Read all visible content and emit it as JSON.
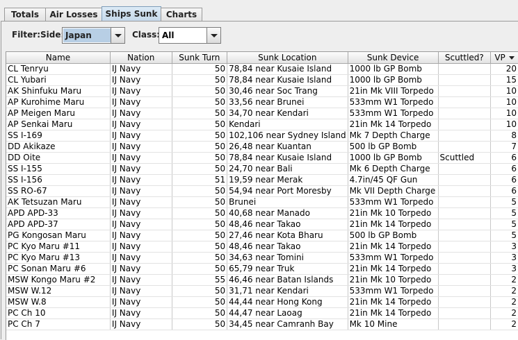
{
  "tabs": [
    {
      "label": "Totals"
    },
    {
      "label": "Air Losses"
    },
    {
      "label": "Ships Sunk",
      "active": true
    },
    {
      "label": "Charts"
    }
  ],
  "filter": {
    "label": "Filter:",
    "side_label": "Side:",
    "side_value": "Japan",
    "class_label": "Class:",
    "class_value": "All"
  },
  "table": {
    "columns": [
      "Name",
      "Nation",
      "Sunk Turn",
      "Sunk Location",
      "Sunk Device",
      "Scuttled?",
      "VP"
    ],
    "sorted_column": "VP",
    "sort_direction": "descending",
    "rows": [
      [
        "CL Tenryu",
        "IJ Navy",
        "50",
        "78,84 near Kusaie Island",
        "1000 lb GP Bomb",
        "",
        "20"
      ],
      [
        "CL Yubari",
        "IJ Navy",
        "50",
        "78,84 near Kusaie Island",
        "1000 lb GP Bomb",
        "",
        "15"
      ],
      [
        "AK Shinfuku Maru",
        "IJ Navy",
        "50",
        "30,46 near Soc Trang",
        "21in Mk VIII Torpedo",
        "",
        "10"
      ],
      [
        "AP Kurohime Maru",
        "IJ Navy",
        "50",
        "33,56 near Brunei",
        "533mm W1 Torpedo",
        "",
        "10"
      ],
      [
        "AP Meigen Maru",
        "IJ Navy",
        "50",
        "34,70 near Kendari",
        "533mm W1 Torpedo",
        "",
        "10"
      ],
      [
        "AP Senkai Maru",
        "IJ Navy",
        "50",
        "Kendari",
        "21in Mk 14 Torpedo",
        "",
        "10"
      ],
      [
        "SS I-169",
        "IJ Navy",
        "50",
        "102,106 near Sydney Island",
        "Mk 7 Depth Charge",
        "",
        "8"
      ],
      [
        "DD Akikaze",
        "IJ Navy",
        "50",
        "26,48 near Kuantan",
        "500 lb GP Bomb",
        "",
        "7"
      ],
      [
        "DD Oite",
        "IJ Navy",
        "50",
        "78,84 near Kusaie Island",
        "1000 lb GP Bomb",
        "Scuttled",
        "6"
      ],
      [
        "SS I-155",
        "IJ Navy",
        "50",
        "24,70 near Bali",
        "Mk 6 Depth Charge",
        "",
        "6"
      ],
      [
        "SS I-156",
        "IJ Navy",
        "51",
        "19,59 near Merak",
        "4.7in/45 QF Gun",
        "",
        "6"
      ],
      [
        "SS RO-67",
        "IJ Navy",
        "50",
        "54,94 near Port Moresby",
        "Mk VII Depth Charge",
        "",
        "6"
      ],
      [
        "AK Tetsuzan Maru",
        "IJ Navy",
        "50",
        "Brunei",
        "533mm W1 Torpedo",
        "",
        "5"
      ],
      [
        "APD APD-33",
        "IJ Navy",
        "50",
        "40,68 near Manado",
        "21in Mk 10 Torpedo",
        "",
        "5"
      ],
      [
        "APD APD-37",
        "IJ Navy",
        "50",
        "48,46 near Takao",
        "21in Mk 14 Torpedo",
        "",
        "5"
      ],
      [
        "PG Kongosan Maru",
        "IJ Navy",
        "50",
        "27,46 near Kota Bharu",
        "500 lb GP Bomb",
        "",
        "5"
      ],
      [
        "PC Kyo Maru #11",
        "IJ Navy",
        "50",
        "48,46 near Takao",
        "21in Mk 14 Torpedo",
        "",
        "3"
      ],
      [
        "PC Kyo Maru #13",
        "IJ Navy",
        "50",
        "34,63 near Tomini",
        "533mm W1 Torpedo",
        "",
        "3"
      ],
      [
        "PC Sonan Maru #6",
        "IJ Navy",
        "50",
        "65,79 near Truk",
        "21in Mk 14 Torpedo",
        "",
        "3"
      ],
      [
        "MSW Kongo Maru #2",
        "IJ Navy",
        "55",
        "46,46 near Batan Islands",
        "21in Mk 10 Torpedo",
        "",
        "2"
      ],
      [
        "MSW W.12",
        "IJ Navy",
        "50",
        "31,71 near Kendari",
        "533mm W1 Torpedo",
        "",
        "2"
      ],
      [
        "MSW W.8",
        "IJ Navy",
        "50",
        "44,44 near Hong Kong",
        "21in Mk 14 Torpedo",
        "",
        "2"
      ],
      [
        "PC Ch 10",
        "IJ Navy",
        "50",
        "44,47 near Laoag",
        "21in Mk 14 Torpedo",
        "",
        "2"
      ],
      [
        "PC Ch 7",
        "IJ Navy",
        "50",
        "34,45 near Camranh Bay",
        "Mk 10 Mine",
        "",
        "2"
      ]
    ]
  }
}
